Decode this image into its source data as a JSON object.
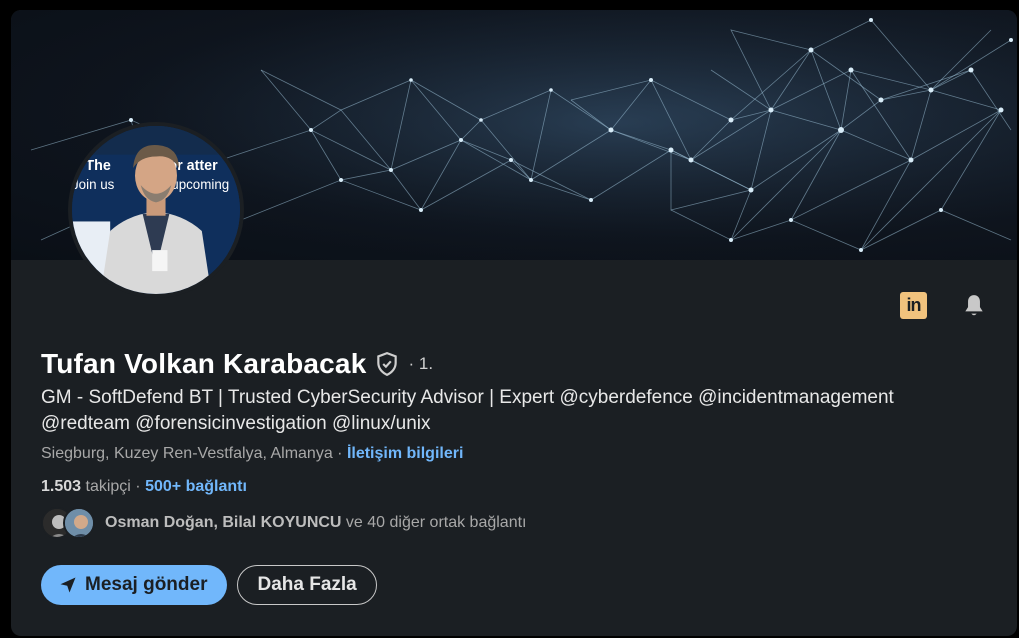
{
  "profile": {
    "name": "Tufan Volkan Karabacak",
    "degree": "· 1.",
    "headline": "GM - SoftDefend BT | Trusted CyberSecurity Advisor | Expert @cyberdefence @incidentmanagement @redteam @forensicinvestigation @linux/unix",
    "location": "Siegburg, Kuzey Ren-Vestfalya, Almanya",
    "location_separator": " · ",
    "contact_info_link": "İletişim bilgileri",
    "followers_count": "1.503",
    "followers_label": " takipçi",
    "connections_separator": " · ",
    "connections_link": "500+ bağlantı",
    "mutual_names": "Osman Doğan, Bilal KOYUNCU",
    "mutual_suffix": " ve 40 diğer ortak bağlantı",
    "avatar_banner_line1": "The",
    "avatar_banner_line1b": "for atter",
    "avatar_banner_line2": "Join us",
    "avatar_banner_line2b": "upcoming"
  },
  "actions": {
    "message_label": "Mesaj gönder",
    "more_label": "Daha Fazla"
  },
  "icons": {
    "linkedin": "linkedin-logo-icon",
    "bell": "bell-icon",
    "verified": "verified-shield-icon",
    "send": "send-paper-plane-icon"
  },
  "colors": {
    "accent": "#71b7fb",
    "card_bg": "#1b1f23",
    "linkedin_logo": "#f1c27d"
  }
}
